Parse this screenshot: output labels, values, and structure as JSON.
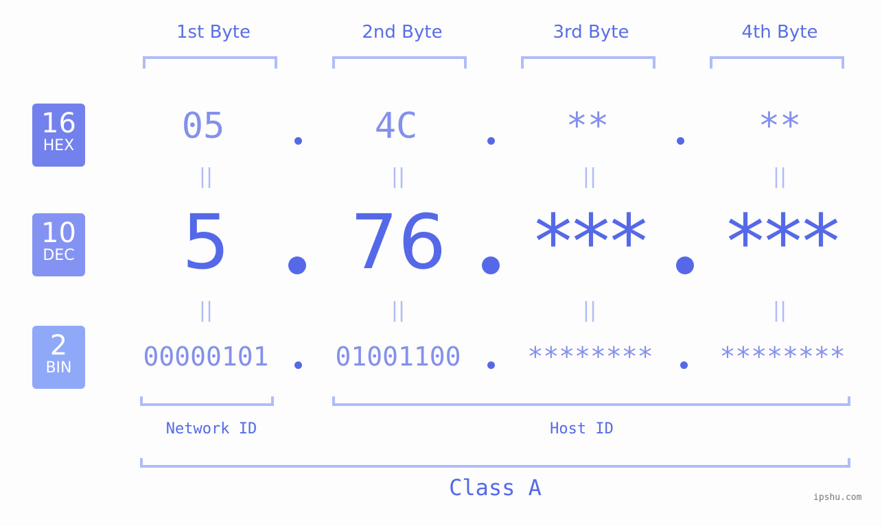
{
  "bytes": [
    {
      "label": "1st Byte",
      "hex": "05",
      "dec": "5",
      "bin": "00000101"
    },
    {
      "label": "2nd Byte",
      "hex": "4C",
      "dec": "76",
      "bin": "01001100"
    },
    {
      "label": "3rd Byte",
      "hex": "**",
      "dec": "***",
      "bin": "********"
    },
    {
      "label": "4th Byte",
      "hex": "**",
      "dec": "***",
      "bin": "********"
    }
  ],
  "bases": [
    {
      "num": "16",
      "name": "HEX",
      "color": "#7281ec"
    },
    {
      "num": "10",
      "name": "DEC",
      "color": "#8493f2"
    },
    {
      "num": "2",
      "name": "BIN",
      "color": "#8fa8f8"
    }
  ],
  "equals_symbol": "||",
  "network_id_label": "Network ID",
  "host_id_label": "Host ID",
  "class_label": "Class A",
  "watermark": "ipshu.com",
  "colors": {
    "accent": "#5569e8",
    "light": "#8490ec",
    "bracket": "#b1bcf7"
  }
}
